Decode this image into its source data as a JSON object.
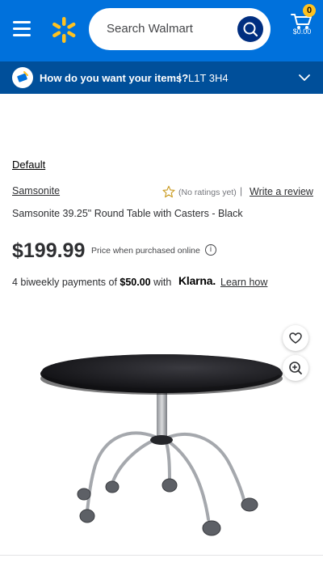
{
  "header": {
    "search_placeholder": "Search Walmart",
    "cart_count": "0",
    "cart_total": "$0.00",
    "brand_color": "#0071dc",
    "spark_color": "#ffc220"
  },
  "delivery": {
    "question": "How do you want your items?",
    "separator": "|",
    "postal_code": "L1T 3H4"
  },
  "product": {
    "variant_link": "Default",
    "brand": "Samsonite",
    "rating_text": "(No ratings yet)",
    "rating_separator": "|",
    "write_review": "Write a review",
    "title": "Samsonite 39.25\" Round Table with Casters - Black",
    "price": "$199.99",
    "price_note": "Price when purchased online",
    "info_glyph": "i",
    "payments_prefix": "4 biweekly payments of ",
    "payments_amount": "$50.00",
    "payments_suffix": " with",
    "klarna": "Klarna.",
    "learn_how": "Learn how"
  },
  "icons": {
    "menu": "hamburger-menu-icon",
    "logo": "walmart-spark-icon",
    "search": "search-icon",
    "cart": "cart-icon",
    "delivery": "delivery-icon",
    "chevron": "chevron-down-icon",
    "star": "star-outline-icon",
    "info": "info-icon",
    "favorite": "heart-icon",
    "zoom": "zoom-in-icon"
  }
}
